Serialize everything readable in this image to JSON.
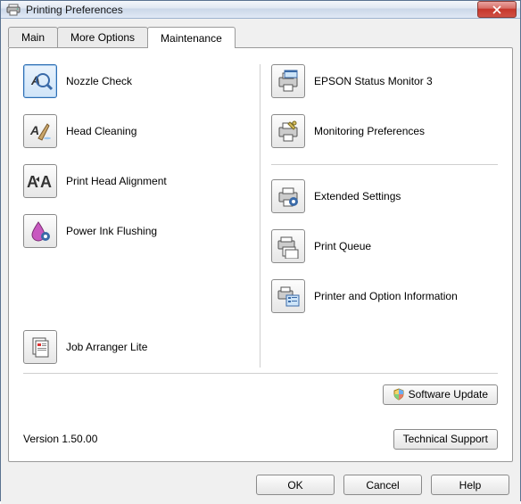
{
  "window": {
    "title": "Printing Preferences"
  },
  "tabs": {
    "main": "Main",
    "more_options": "More Options",
    "maintenance": "Maintenance"
  },
  "left_items": {
    "nozzle_check": "Nozzle Check",
    "head_cleaning": "Head Cleaning",
    "print_head_alignment": "Print Head Alignment",
    "power_ink_flushing": "Power Ink Flushing",
    "job_arranger_lite": "Job Arranger Lite"
  },
  "right_items": {
    "epson_status_monitor": "EPSON Status Monitor 3",
    "monitoring_preferences": "Monitoring Preferences",
    "extended_settings": "Extended Settings",
    "print_queue": "Print Queue",
    "printer_option_info": "Printer and Option Information"
  },
  "buttons": {
    "software_update": "Software Update",
    "technical_support": "Technical Support",
    "ok": "OK",
    "cancel": "Cancel",
    "help": "Help"
  },
  "version": "Version 1.50.00"
}
